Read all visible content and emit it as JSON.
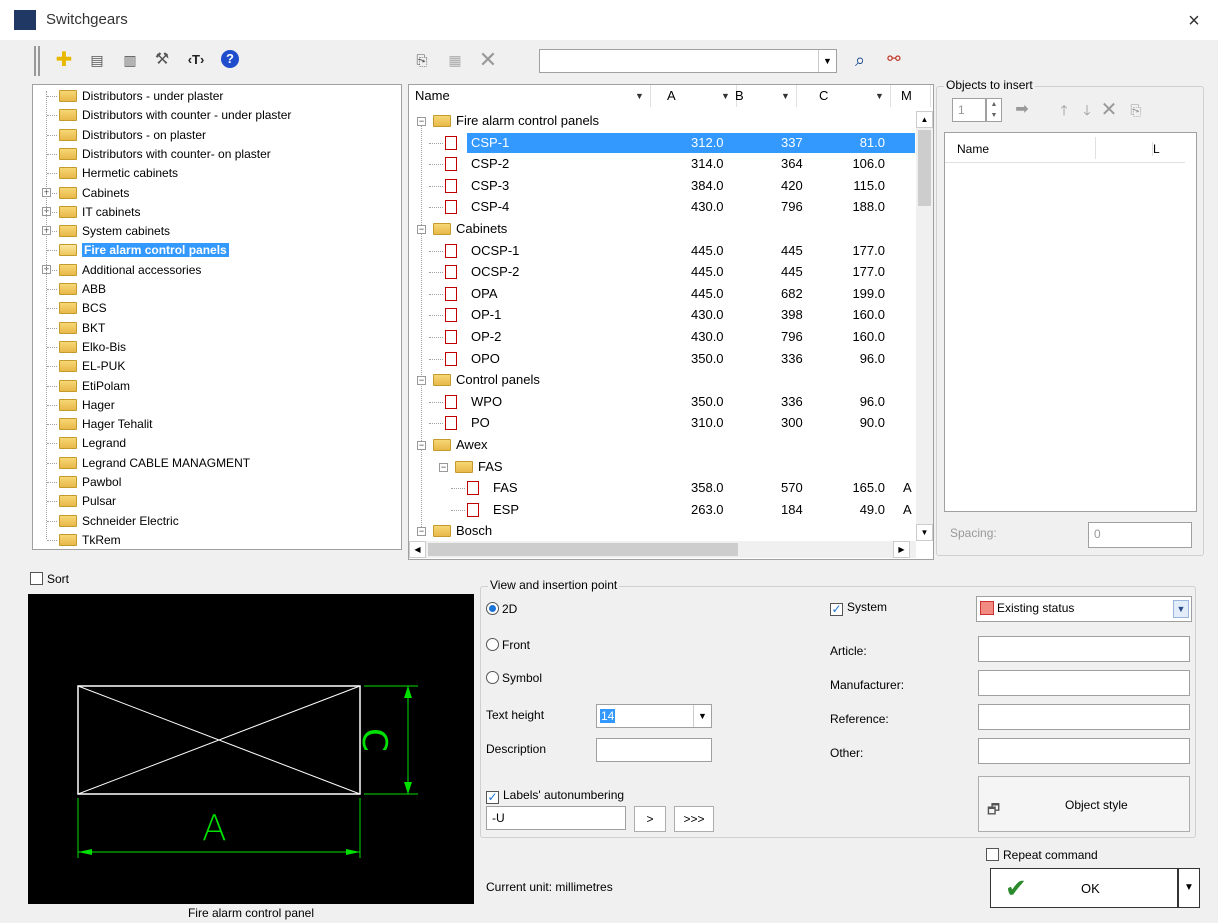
{
  "window": {
    "title": "Switchgears",
    "close": "×"
  },
  "toolbar": {
    "icons": [
      "grip",
      "add-icon",
      "list-icon",
      "doc-icon",
      "tools-icon",
      "text-tag-icon",
      "help-icon",
      "copy-icon",
      "table-icon",
      "delete-icon",
      "search-icon",
      "binoculars-icon"
    ],
    "search_value": ""
  },
  "left_tree": [
    {
      "label": "Distributors - under plaster",
      "expand": false,
      "bold": false,
      "open": false
    },
    {
      "label": "Distributors with counter - under plaster",
      "expand": false
    },
    {
      "label": "Distributors - on plaster",
      "expand": false
    },
    {
      "label": "Distributors with counter- on plaster",
      "expand": false
    },
    {
      "label": "Hermetic cabinets",
      "expand": false
    },
    {
      "label": "Cabinets",
      "expand": true
    },
    {
      "label": "IT cabinets",
      "expand": true
    },
    {
      "label": "System cabinets",
      "expand": true
    },
    {
      "label": "Fire alarm control panels",
      "expand": false,
      "selected": true
    },
    {
      "label": "Additional accessories",
      "expand": true
    },
    {
      "label": "ABB"
    },
    {
      "label": "BCS"
    },
    {
      "label": "BKT"
    },
    {
      "label": "Elko-Bis"
    },
    {
      "label": "EL-PUK"
    },
    {
      "label": "EtiPolam"
    },
    {
      "label": "Hager"
    },
    {
      "label": "Hager Tehalit"
    },
    {
      "label": "Legrand"
    },
    {
      "label": "Legrand CABLE MANAGMENT"
    },
    {
      "label": "Pawbol"
    },
    {
      "label": "Pulsar"
    },
    {
      "label": "Schneider Electric"
    },
    {
      "label": "TkRem"
    }
  ],
  "grid": {
    "headers": [
      "Name",
      "A",
      "B",
      "C",
      "M"
    ],
    "rows": [
      {
        "type": "group",
        "label": "Fire alarm control panels",
        "level": 0
      },
      {
        "type": "item",
        "label": "CSP-1",
        "a": "312.0",
        "b": "337",
        "c": "81.0",
        "m": "",
        "level": 1,
        "selected": true
      },
      {
        "type": "item",
        "label": "CSP-2",
        "a": "314.0",
        "b": "364",
        "c": "106.0",
        "m": "",
        "level": 1
      },
      {
        "type": "item",
        "label": "CSP-3",
        "a": "384.0",
        "b": "420",
        "c": "115.0",
        "m": "",
        "level": 1
      },
      {
        "type": "item",
        "label": "CSP-4",
        "a": "430.0",
        "b": "796",
        "c": "188.0",
        "m": "",
        "level": 1
      },
      {
        "type": "group",
        "label": "Cabinets",
        "level": 0
      },
      {
        "type": "item",
        "label": "OCSP-1",
        "a": "445.0",
        "b": "445",
        "c": "177.0",
        "m": "",
        "level": 1
      },
      {
        "type": "item",
        "label": "OCSP-2",
        "a": "445.0",
        "b": "445",
        "c": "177.0",
        "m": "",
        "level": 1
      },
      {
        "type": "item",
        "label": "OPA",
        "a": "445.0",
        "b": "682",
        "c": "199.0",
        "m": "",
        "level": 1
      },
      {
        "type": "item",
        "label": "OP-1",
        "a": "430.0",
        "b": "398",
        "c": "160.0",
        "m": "",
        "level": 1
      },
      {
        "type": "item",
        "label": "OP-2",
        "a": "430.0",
        "b": "796",
        "c": "160.0",
        "m": "",
        "level": 1
      },
      {
        "type": "item",
        "label": "OPO",
        "a": "350.0",
        "b": "336",
        "c": "96.0",
        "m": "",
        "level": 1
      },
      {
        "type": "group",
        "label": "Control panels",
        "level": 0
      },
      {
        "type": "item",
        "label": "WPO",
        "a": "350.0",
        "b": "336",
        "c": "96.0",
        "m": "",
        "level": 1
      },
      {
        "type": "item",
        "label": "PO",
        "a": "310.0",
        "b": "300",
        "c": "90.0",
        "m": "",
        "level": 1
      },
      {
        "type": "group",
        "label": "Awex",
        "level": 0
      },
      {
        "type": "group",
        "label": "FAS",
        "level": 1
      },
      {
        "type": "item",
        "label": "FAS",
        "a": "358.0",
        "b": "570",
        "c": "165.0",
        "m": "A",
        "level": 2
      },
      {
        "type": "item",
        "label": "ESP",
        "a": "263.0",
        "b": "184",
        "c": "49.0",
        "m": "A",
        "level": 2
      },
      {
        "type": "group",
        "label": "Bosch",
        "level": 0
      }
    ]
  },
  "objects_to_insert": {
    "title": "Objects to insert",
    "count": "1",
    "col_name": "Name",
    "col_l": "L",
    "spacing_label": "Spacing:",
    "spacing_value": "0"
  },
  "sort_label": "Sort",
  "preview": {
    "caption": "Fire alarm control panel",
    "dim_a": "A",
    "dim_c": "C"
  },
  "view": {
    "title": "View and insertion point",
    "opt_2d": "2D",
    "opt_front": "Front",
    "opt_symbol": "Symbol",
    "text_height_label": "Text height",
    "text_height_value": "14",
    "description_label": "Description",
    "description_value": "",
    "autonum_label": "Labels' autonumbering",
    "autonum_value": "-U",
    "btn_next": ">",
    "btn_all": ">>>"
  },
  "props": {
    "system_label": "System",
    "status_value": "Existing status",
    "status_color": "#f28b82",
    "article_label": "Article:",
    "manufacturer_label": "Manufacturer:",
    "reference_label": "Reference:",
    "other_label": "Other:",
    "object_style_label": "Object style"
  },
  "repeat_label": "Repeat command",
  "ok_label": "OK",
  "unit_label": "Current unit: millimetres"
}
